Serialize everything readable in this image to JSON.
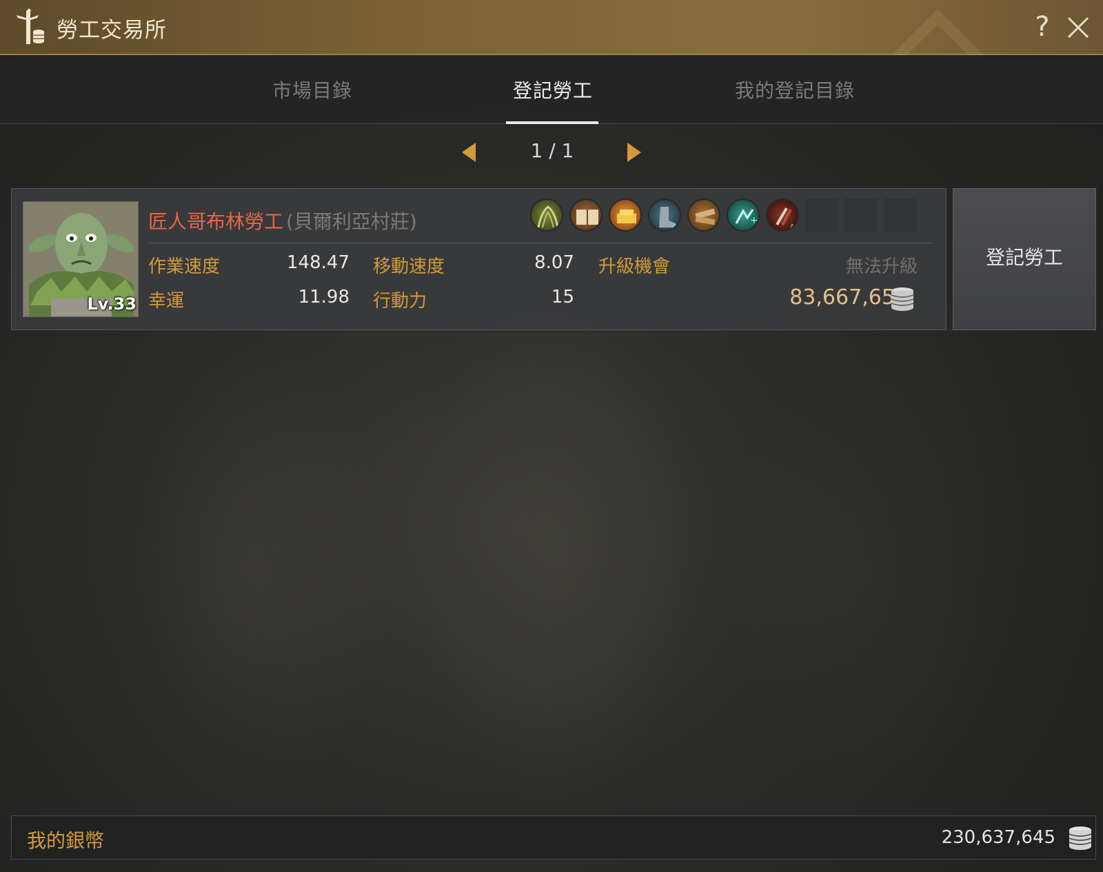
{
  "window": {
    "title": "勞工交易所",
    "help_label": "?"
  },
  "tabs": [
    {
      "label": "市場目錄",
      "active": false
    },
    {
      "label": "登記勞工",
      "active": true
    },
    {
      "label": "我的登記目錄",
      "active": false
    }
  ],
  "pager": {
    "text": "1 / 1"
  },
  "worker": {
    "name": "匠人哥布林勞工",
    "town": "(貝爾利亞村莊)",
    "level": "Lv.33",
    "skills": [
      "skill-harvest-icon",
      "skill-book-icon",
      "skill-gold-icon",
      "skill-boot-c-icon",
      "skill-lumber-icon",
      "skill-speed-icon",
      "skill-tool-a-icon"
    ],
    "empty_skill_slots": 3,
    "stats": {
      "work_speed_label": "作業速度",
      "work_speed_value": "148.47",
      "move_speed_label": "移動速度",
      "move_speed_value": "8.07",
      "upgrade_label": "升級機會",
      "upgrade_value": "無法升級",
      "luck_label": "幸運",
      "luck_value": "11.98",
      "stamina_label": "行動力",
      "stamina_value": "15"
    },
    "price": "83,667,650"
  },
  "register_button": {
    "label": "登記勞工"
  },
  "footer": {
    "label": "我的銀幣",
    "value": "230,637,645"
  },
  "colors": {
    "accent_orange": "#d29a3a",
    "name_red": "#e5674a",
    "price_gold": "#e3c28a",
    "titlebar_gold": "#7a6136"
  }
}
